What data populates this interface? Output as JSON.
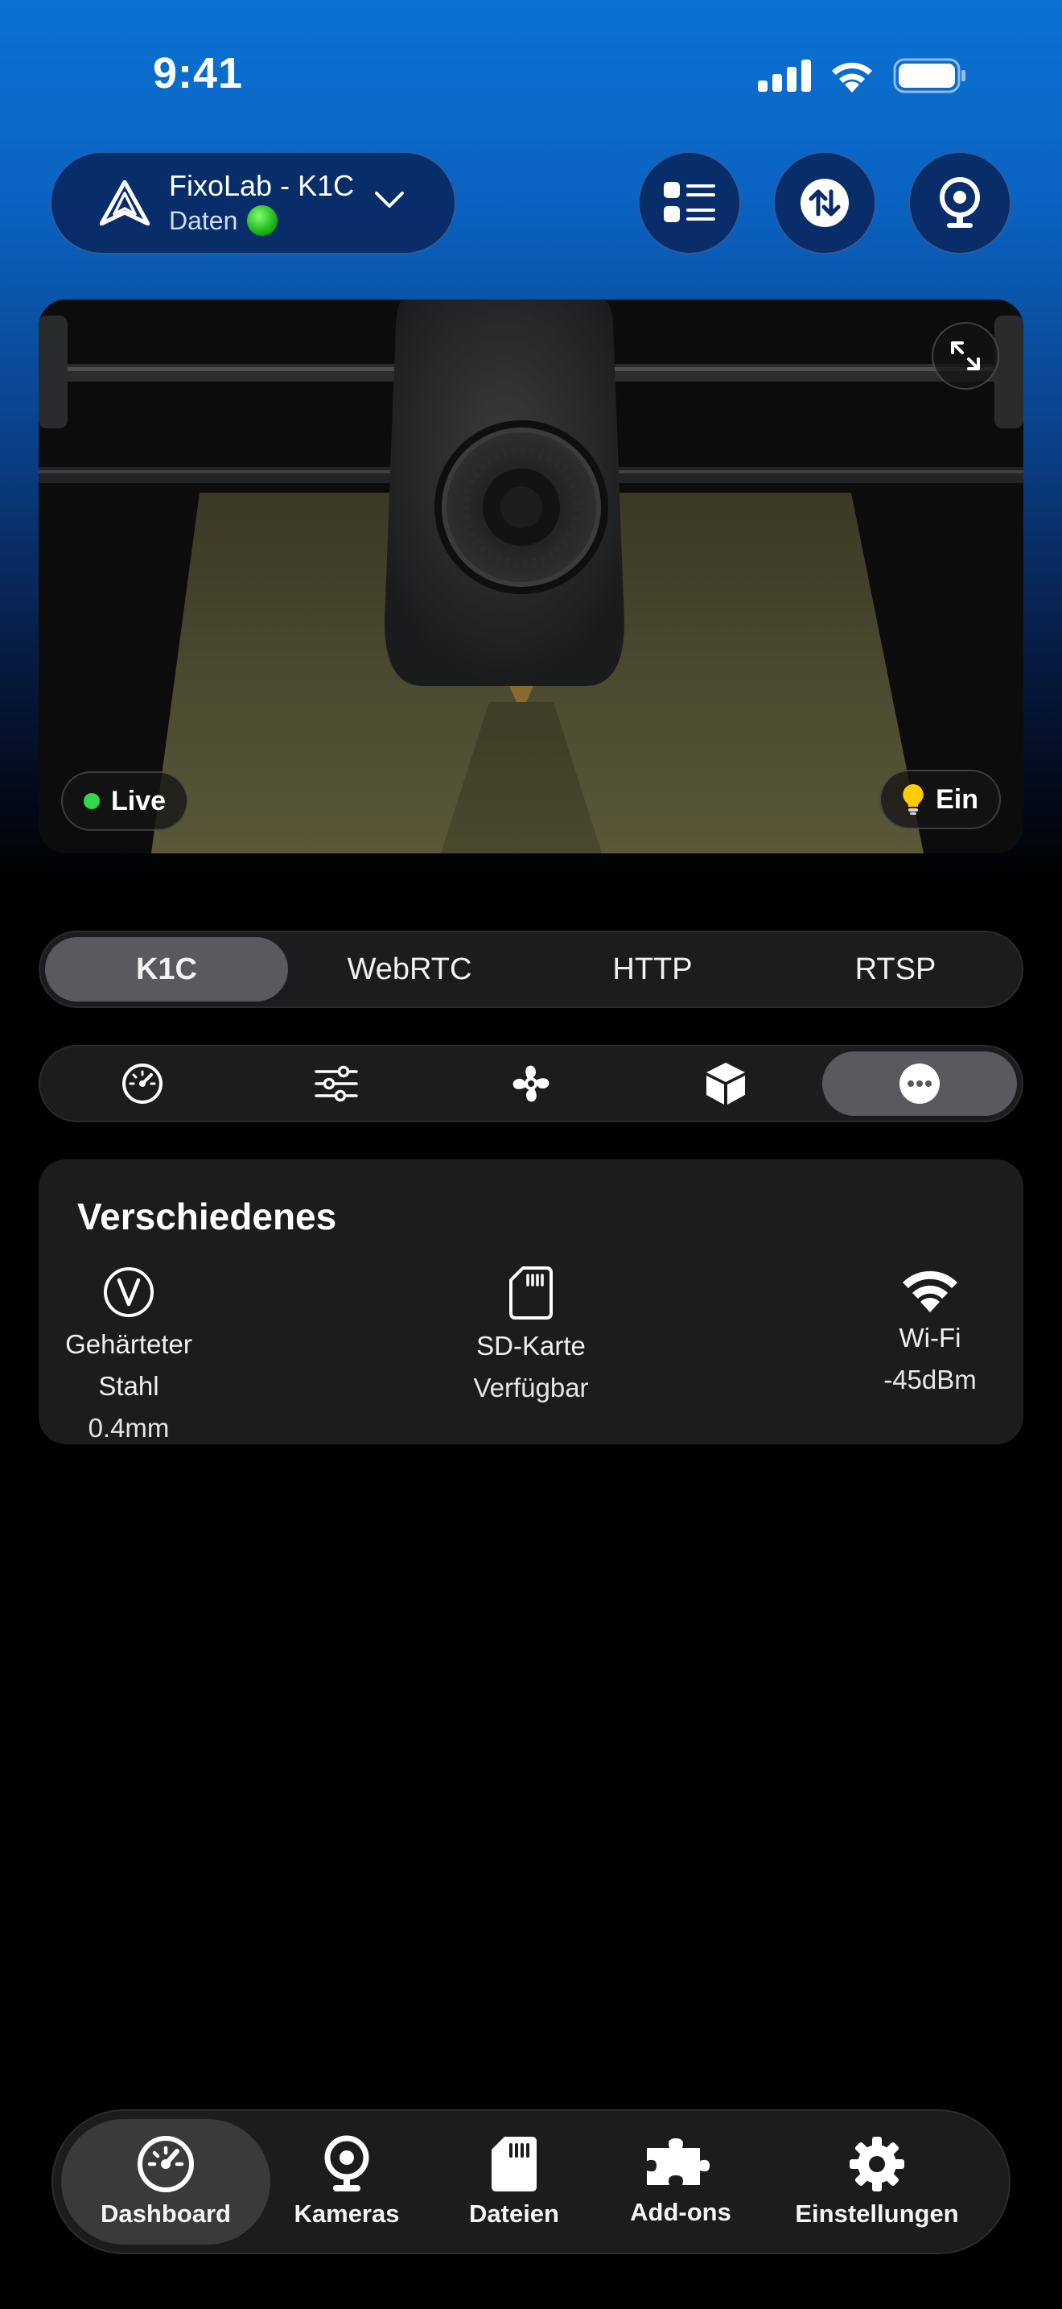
{
  "status_bar": {
    "time": "9:41"
  },
  "header": {
    "printer_name": "FixoLab - K1C",
    "printer_status": "Daten"
  },
  "camera": {
    "live_label": "Live",
    "light_label": "Ein"
  },
  "stream_tabs": [
    {
      "label": "K1C",
      "active": true
    },
    {
      "label": "WebRTC",
      "active": false
    },
    {
      "label": "HTTP",
      "active": false
    },
    {
      "label": "RTSP",
      "active": false
    }
  ],
  "section_tabs": [
    {
      "icon": "speedometer-icon",
      "active": false
    },
    {
      "icon": "sliders-icon",
      "active": false
    },
    {
      "icon": "fan-icon",
      "active": false
    },
    {
      "icon": "box-icon",
      "active": false
    },
    {
      "icon": "more-icon",
      "active": true
    }
  ],
  "misc_card": {
    "title": "Verschiedenes",
    "items": [
      {
        "icon": "nozzle-v-icon",
        "label": "Gehärteter Stahl",
        "value": "0.4mm"
      },
      {
        "icon": "sd-card-icon",
        "label": "SD-Karte",
        "value": "Verfügbar"
      },
      {
        "icon": "wifi-icon",
        "label": "Wi-Fi",
        "value": "-45dBm"
      }
    ]
  },
  "bottom_nav": [
    {
      "icon": "dashboard-icon",
      "label": "Dashboard",
      "active": true
    },
    {
      "icon": "camera-icon",
      "label": "Kameras",
      "active": false
    },
    {
      "icon": "sd-card-icon",
      "label": "Dateien",
      "active": false
    },
    {
      "icon": "puzzle-icon",
      "label": "Add-ons",
      "active": false
    },
    {
      "icon": "gear-icon",
      "label": "Einstellungen",
      "active": false
    }
  ],
  "colors": {
    "accent_blue": "#0a72d4",
    "live_green": "#32d74b",
    "surface": "#1c1c1e",
    "active_segment": "#5a5a5e"
  }
}
